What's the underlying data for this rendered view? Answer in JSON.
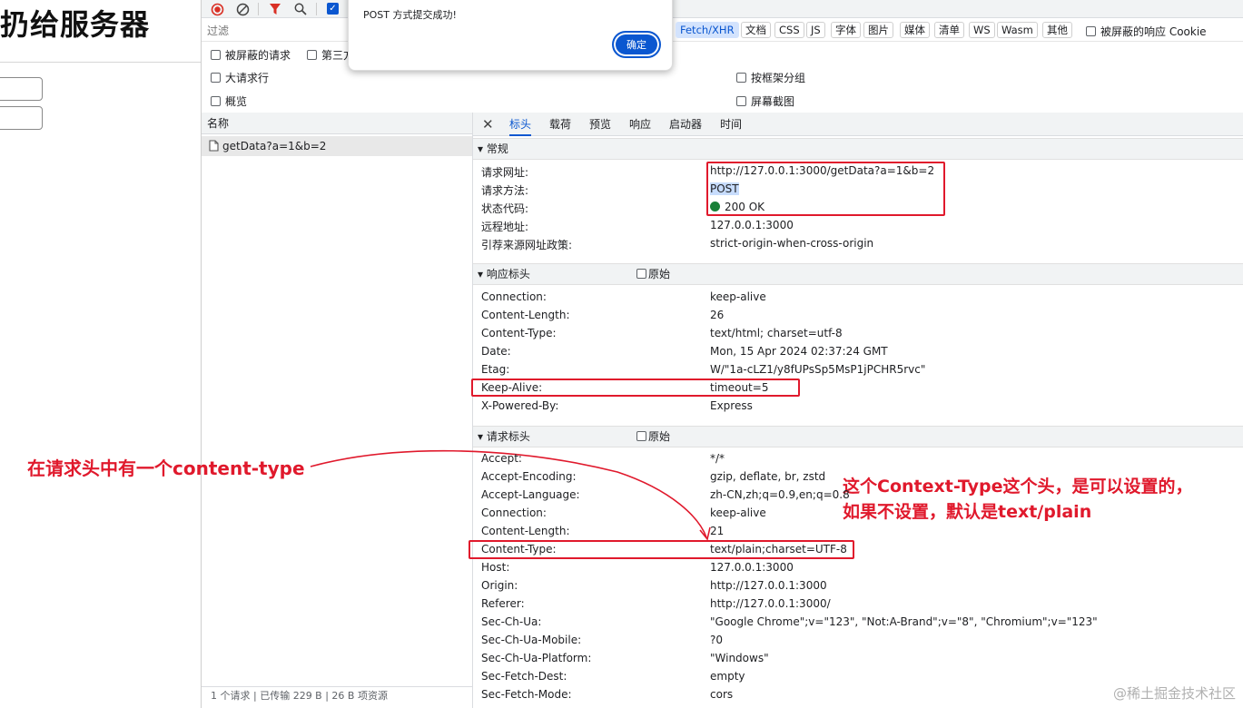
{
  "page": {
    "heading": "扔给服务器"
  },
  "toolbar": {
    "record_icon": "record-icon",
    "clear_icon": "clear-icon",
    "filter_icon": "filter-icon",
    "search_icon": "search-icon"
  },
  "filter": {
    "placeholder": "过滤",
    "types": [
      "Fetch/XHR",
      "文档",
      "CSS",
      "JS",
      "字体",
      "图片",
      "媒体",
      "清单",
      "WS",
      "Wasm",
      "其他"
    ],
    "active_type": "Fetch/XHR",
    "blocked_cookies": "被屏蔽的响应 Cookie",
    "blocked_requests": "被屏蔽的请求",
    "third_party": "第三方",
    "big_rows": "大请求行",
    "overview": "概览",
    "group_by_frame": "按框架分组",
    "screenshots": "屏幕截图"
  },
  "dialog": {
    "message": "POST 方式提交成功!",
    "ok_label": "确定"
  },
  "names": {
    "header": "名称",
    "request": "getData?a=1&b=2",
    "status_bar": "1 个请求  |  已传输 229 B  |  26 B 项资源"
  },
  "tabs": {
    "labels": [
      "标头",
      "载荷",
      "预览",
      "响应",
      "启动器",
      "时间"
    ],
    "active": "标头"
  },
  "general": {
    "title": "▾ 常规",
    "rows": [
      {
        "k": "请求网址:",
        "v": "http://127.0.0.1:3000/getData?a=1&b=2"
      },
      {
        "k": "请求方法:",
        "v": "POST"
      },
      {
        "k": "状态代码:",
        "v": "200 OK"
      },
      {
        "k": "远程地址:",
        "v": "127.0.0.1:3000"
      },
      {
        "k": "引荐来源网址政策:",
        "v": "strict-origin-when-cross-origin"
      }
    ]
  },
  "response_headers": {
    "title": "▾ 响应标头",
    "raw_label": "原始",
    "rows": [
      {
        "k": "Connection:",
        "v": "keep-alive"
      },
      {
        "k": "Content-Length:",
        "v": "26"
      },
      {
        "k": "Content-Type:",
        "v": "text/html; charset=utf-8"
      },
      {
        "k": "Date:",
        "v": "Mon, 15 Apr 2024 02:37:24 GMT"
      },
      {
        "k": "Etag:",
        "v": "W/\"1a-cLZ1/y8fUPsSp5MsP1jPCHR5rvc\""
      },
      {
        "k": "Keep-Alive:",
        "v": "timeout=5"
      },
      {
        "k": "X-Powered-By:",
        "v": "Express"
      }
    ]
  },
  "request_headers": {
    "title": "▾ 请求标头",
    "raw_label": "原始",
    "rows": [
      {
        "k": "Accept:",
        "v": "*/*"
      },
      {
        "k": "Accept-Encoding:",
        "v": "gzip, deflate, br, zstd"
      },
      {
        "k": "Accept-Language:",
        "v": "zh-CN,zh;q=0.9,en;q=0.8"
      },
      {
        "k": "Connection:",
        "v": "keep-alive"
      },
      {
        "k": "Content-Length:",
        "v": "21"
      },
      {
        "k": "Content-Type:",
        "v": "text/plain;charset=UTF-8"
      },
      {
        "k": "Host:",
        "v": "127.0.0.1:3000"
      },
      {
        "k": "Origin:",
        "v": "http://127.0.0.1:3000"
      },
      {
        "k": "Referer:",
        "v": "http://127.0.0.1:3000/"
      },
      {
        "k": "Sec-Ch-Ua:",
        "v": "\"Google Chrome\";v=\"123\", \"Not:A-Brand\";v=\"8\", \"Chromium\";v=\"123\""
      },
      {
        "k": "Sec-Ch-Ua-Mobile:",
        "v": "?0"
      },
      {
        "k": "Sec-Ch-Ua-Platform:",
        "v": "\"Windows\""
      },
      {
        "k": "Sec-Fetch-Dest:",
        "v": "empty"
      },
      {
        "k": "Sec-Fetch-Mode:",
        "v": "cors"
      }
    ]
  },
  "annotations": {
    "left_note": "在请求头中有一个content-type",
    "right_note_line1": "这个Context-Type这个头，是可以设置的，",
    "right_note_line2": "如果不设置，默认是text/plain",
    "color": "#e0192c"
  },
  "watermark": "@稀土掘金技术社区",
  "colors": {
    "accent": "#0b57d0",
    "status_ok": "#188038",
    "annotation": "#e0192c"
  }
}
